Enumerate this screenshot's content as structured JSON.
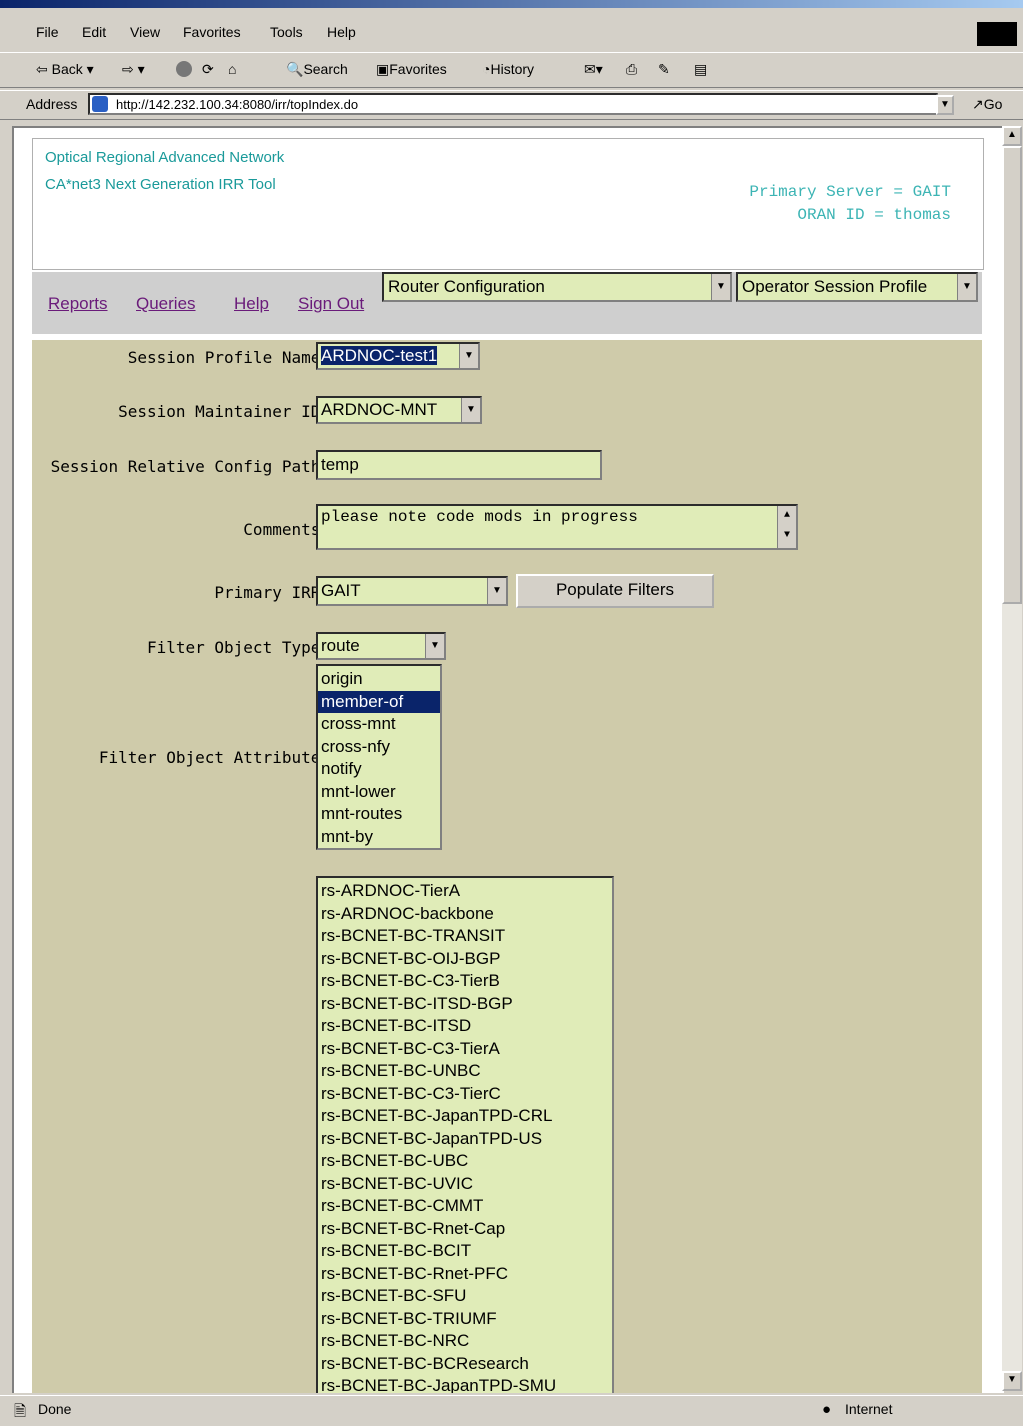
{
  "menu": {
    "file": "File",
    "edit": "Edit",
    "view": "View",
    "favorites": "Favorites",
    "tools": "Tools",
    "help": "Help"
  },
  "toolbar": {
    "back": "Back",
    "search": "Search",
    "favorites": "Favorites",
    "history": "History"
  },
  "address": {
    "label": "Address",
    "url": "http://142.232.100.34:8080/irr/topIndex.do",
    "go": "Go"
  },
  "header": {
    "line1": "Optical Regional Advanced Network",
    "line2": "CA*net3 Next Generation IRR Tool",
    "server": "Primary Server = GAIT",
    "oran": "ORAN ID = thomas"
  },
  "nav": {
    "reports": "Reports",
    "queries": "Queries",
    "help": "Help",
    "signout": "Sign Out",
    "select1": "Router Configuration",
    "select2": "Operator Session Profile"
  },
  "form": {
    "profile_label": "Session Profile Name:",
    "profile_value": "ARDNOC-test1",
    "maintainer_label": "Session Maintainer ID:",
    "maintainer_value": "ARDNOC-MNT",
    "path_label": "Session Relative Config Path:",
    "path_value": "temp",
    "comments_label": "Comments:",
    "comments_value": "please note code mods in progress",
    "irr_label": "Primary IRR:",
    "irr_value": "GAIT",
    "populate_label": "Populate Filters",
    "objtype_label": "Filter Object Type:",
    "objtype_value": "route",
    "attr_label": "Filter Object Attribute:",
    "attributes": [
      "origin",
      "member-of",
      "cross-mnt",
      "cross-nfy",
      "notify",
      "mnt-lower",
      "mnt-routes",
      "mnt-by"
    ],
    "selected_attribute": "member-of",
    "filters": [
      "rs-ARDNOC-TierA",
      "rs-ARDNOC-backbone",
      "rs-BCNET-BC-TRANSIT",
      "rs-BCNET-BC-OIJ-BGP",
      "rs-BCNET-BC-C3-TierB",
      "rs-BCNET-BC-ITSD-BGP",
      "rs-BCNET-BC-ITSD",
      "rs-BCNET-BC-C3-TierA",
      "rs-BCNET-BC-UNBC",
      "rs-BCNET-BC-C3-TierC",
      "rs-BCNET-BC-JapanTPD-CRL",
      "rs-BCNET-BC-JapanTPD-US",
      "rs-BCNET-BC-UBC",
      "rs-BCNET-BC-UVIC",
      "rs-BCNET-BC-CMMT",
      "rs-BCNET-BC-Rnet-Cap",
      "rs-BCNET-BC-BCIT",
      "rs-BCNET-BC-Rnet-PFC",
      "rs-BCNET-BC-SFU",
      "rs-BCNET-BC-TRIUMF",
      "rs-BCNET-BC-NRC",
      "rs-BCNET-BC-BCResearch",
      "rs-BCNET-BC-JapanTPD-SMU"
    ]
  },
  "status": {
    "text": "Done",
    "zone": "Internet"
  }
}
